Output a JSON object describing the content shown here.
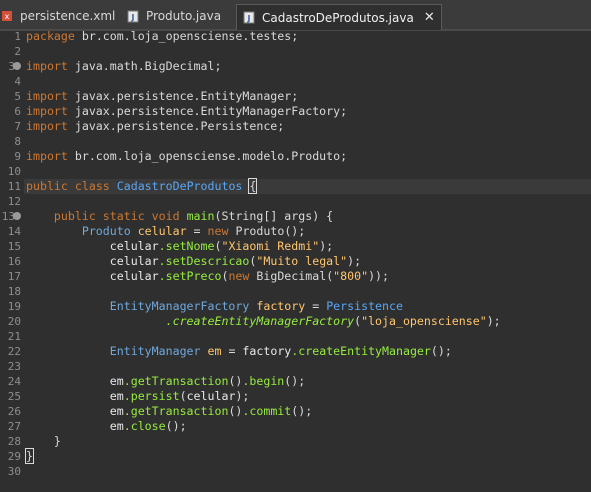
{
  "tabs": [
    {
      "label": "persistence.xml",
      "icon": "xml-file-icon",
      "active": false
    },
    {
      "label": "Produto.java",
      "icon": "java-file-icon",
      "active": false
    },
    {
      "label": "CadastroDeProdutos.java",
      "icon": "java-file-icon",
      "active": true,
      "close": "✕"
    }
  ],
  "line_numbers": [
    "1",
    "2",
    "3",
    "4",
    "5",
    "6",
    "7",
    "8",
    "9",
    "10",
    "11",
    "12",
    "13",
    "14",
    "15",
    "16",
    "17",
    "18",
    "19",
    "20",
    "21",
    "22",
    "23",
    "24",
    "25",
    "26",
    "27",
    "28",
    "29",
    "30"
  ],
  "code": {
    "l1": {
      "kw": "package",
      "rest": " br.com.loja_opensciense.testes;"
    },
    "l3": {
      "kw": "import",
      "rest": " java.math.BigDecimal;"
    },
    "l5": {
      "kw": "import",
      "rest": " javax.persistence.EntityManager;"
    },
    "l6": {
      "kw": "import",
      "rest": " javax.persistence.EntityManagerFactory;"
    },
    "l7": {
      "kw": "import",
      "rest": " javax.persistence.Persistence;"
    },
    "l9": {
      "kw": "import",
      "rest": " br.com.loja_opensciense.modelo.Produto;"
    },
    "l11": {
      "kw1": "public",
      "kw2": "class",
      "name": "CadastroDeProdutos",
      "brace": "{"
    },
    "l13": {
      "kw1": "public",
      "kw2": "static",
      "kw3": "void",
      "method": "main",
      "params": "(String[] args) {"
    },
    "l14": {
      "type": "Produto",
      "var": "celular",
      "eq": " = ",
      "kw": "new",
      "rest": " Produto();"
    },
    "l15": {
      "obj": "celular",
      "method": ".setNome",
      "open": "(",
      "str": "\"Xiaomi Redmi\"",
      "close": ");"
    },
    "l16": {
      "obj": "celular",
      "method": ".setDescricao",
      "open": "(",
      "str": "\"Muito legal\"",
      "close": ");"
    },
    "l17": {
      "obj": "celular",
      "method": ".setPreco",
      "open": "(",
      "kw": "new",
      "type": " BigDecimal",
      "open2": "(",
      "str": "\"800\"",
      "close": "));"
    },
    "l19": {
      "type": "EntityManagerFactory",
      "var": "factory",
      "eq": " = ",
      "cls": "Persistence"
    },
    "l20": {
      "static": ".createEntityManagerFactory",
      "open": "(",
      "str": "\"loja_opensciense\"",
      "close": ");"
    },
    "l22": {
      "type": "EntityManager",
      "var": "em",
      "eq": " = ",
      "obj": "factory",
      "method": ".createEntityManager",
      "close": "();"
    },
    "l24": {
      "obj": "em",
      "m1": ".getTransaction",
      "p1": "()",
      "m2": ".begin",
      "close": "();"
    },
    "l25": {
      "obj": "em",
      "m1": ".persist",
      "open": "(",
      "arg": "celular",
      "close": ");"
    },
    "l26": {
      "obj": "em",
      "m1": ".getTransaction",
      "p1": "()",
      "m2": ".commit",
      "close": "();"
    },
    "l27": {
      "obj": "em",
      "m1": ".close",
      "close": "();"
    },
    "l28": {
      "text": "}"
    },
    "l29": {
      "text": "}"
    }
  },
  "colors": {
    "background": "#2f2f2f",
    "keyword": "#cc7832",
    "type": "#6fa8dc",
    "method": "#96ec3f",
    "string": "#ffc66d"
  }
}
